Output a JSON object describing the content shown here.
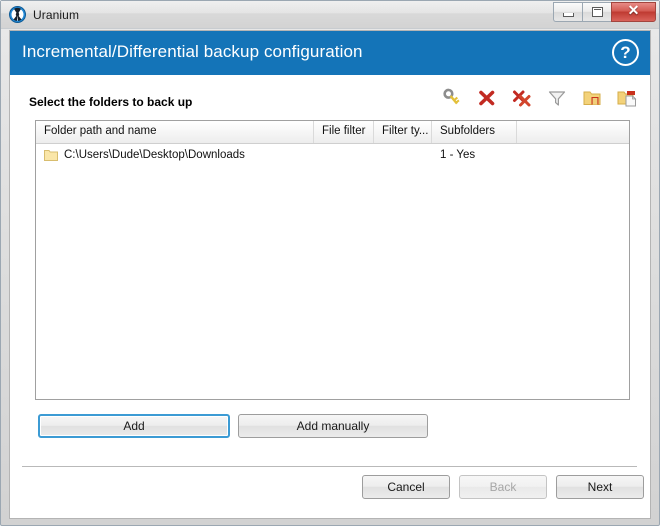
{
  "window": {
    "title": "Uranium",
    "app_icon": "radiation-icon",
    "controls": {
      "minimize": "minimize-icon",
      "maximize": "maximize-icon",
      "close": "✕"
    }
  },
  "banner": {
    "title": "Incremental/Differential backup configuration",
    "help_label": "?",
    "background_color": "#1474b8"
  },
  "content": {
    "section_label": "Select the folders to back up",
    "toolbar": [
      {
        "name": "permissions-key-icon",
        "tooltip": "Permissions"
      },
      {
        "name": "delete-icon",
        "tooltip": "Delete"
      },
      {
        "name": "delete-all-icon",
        "tooltip": "Delete all"
      },
      {
        "name": "filter-icon",
        "tooltip": "Filter"
      },
      {
        "name": "folder-icon",
        "tooltip": "Folder"
      },
      {
        "name": "folder-file-icon",
        "tooltip": "Folder and file"
      }
    ],
    "table": {
      "columns": [
        "Folder path and name",
        "File filter",
        "Filter ty...",
        "Subfolders",
        ""
      ],
      "rows": [
        {
          "folder": "C:\\Users\\Dude\\Desktop\\Downloads",
          "file_filter": "",
          "filter_type": "",
          "subfolders": "1 - Yes",
          "extra": ""
        }
      ]
    },
    "buttons": {
      "add": "Add",
      "add_manually": "Add manually"
    }
  },
  "footer": {
    "cancel": "Cancel",
    "back": "Back",
    "next": "Next"
  }
}
